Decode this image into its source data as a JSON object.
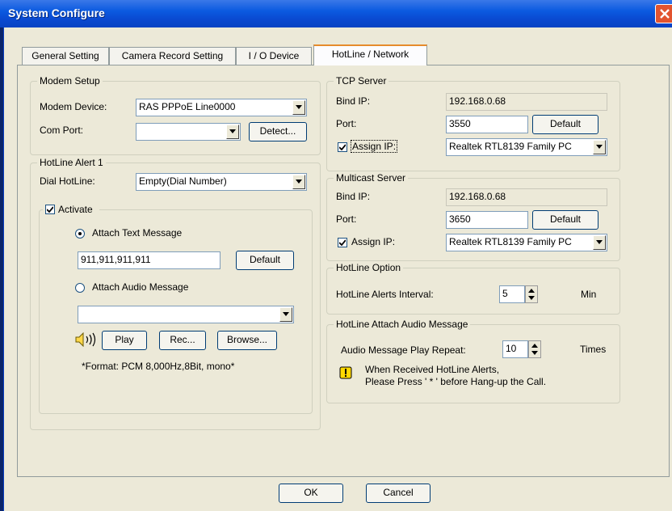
{
  "window": {
    "title": "System Configure"
  },
  "tabs": [
    {
      "label": "General Setting"
    },
    {
      "label": "Camera Record Setting"
    },
    {
      "label": "I / O Device"
    },
    {
      "label": "HotLine / Network"
    }
  ],
  "modem": {
    "legend": "Modem Setup",
    "device_label": "Modem Device:",
    "device_value": "RAS PPPoE Line0000",
    "com_label": "Com Port:",
    "com_value": "",
    "detect_label": "Detect..."
  },
  "hotline_alert": {
    "legend": "HotLine Alert 1",
    "dial_label": "Dial HotLine:",
    "dial_value": "Empty(Dial Number)",
    "activate_label": "Activate",
    "activate_checked": true,
    "attach_text_label": "Attach Text Message",
    "text_value": "911,911,911,911",
    "default_label": "Default",
    "attach_audio_label": "Attach Audio Message",
    "audio_value": "",
    "play_label": "Play",
    "rec_label": "Rec...",
    "browse_label": "Browse...",
    "format_note": "*Format: PCM 8,000Hz,8Bit, mono*"
  },
  "tcp": {
    "legend": "TCP Server",
    "bind_label": "Bind IP:",
    "bind_value": "192.168.0.68",
    "port_label": "Port:",
    "port_value": "3550",
    "default_label": "Default",
    "assign_label": "Assign IP:",
    "assign_checked": true,
    "adapter_value": "Realtek RTL8139 Family PC"
  },
  "multicast": {
    "legend": "Multicast Server",
    "bind_label": "Bind IP:",
    "bind_value": "192.168.0.68",
    "port_label": "Port:",
    "port_value": "3650",
    "default_label": "Default",
    "assign_label": "Assign IP:",
    "assign_checked": true,
    "adapter_value": "Realtek RTL8139 Family PC"
  },
  "hotline_option": {
    "legend": "HotLine Option",
    "interval_label": "HotLine Alerts Interval:",
    "interval_value": "5",
    "unit": "Min"
  },
  "audio_message": {
    "legend": "HotLine Attach Audio Message",
    "repeat_label": "Audio Message Play Repeat:",
    "repeat_value": "10",
    "unit": "Times",
    "note_line1": "When Received HotLine Alerts,",
    "note_line2": "Please Press ' * ' before Hang-up the Call."
  },
  "footer": {
    "ok_label": "OK",
    "cancel_label": "Cancel"
  },
  "colors": {
    "titlebar": "#0b5ae0",
    "dialog_bg": "#ece9d8",
    "active_tab_accent": "#e68b2c",
    "close_button": "#e2542f"
  }
}
